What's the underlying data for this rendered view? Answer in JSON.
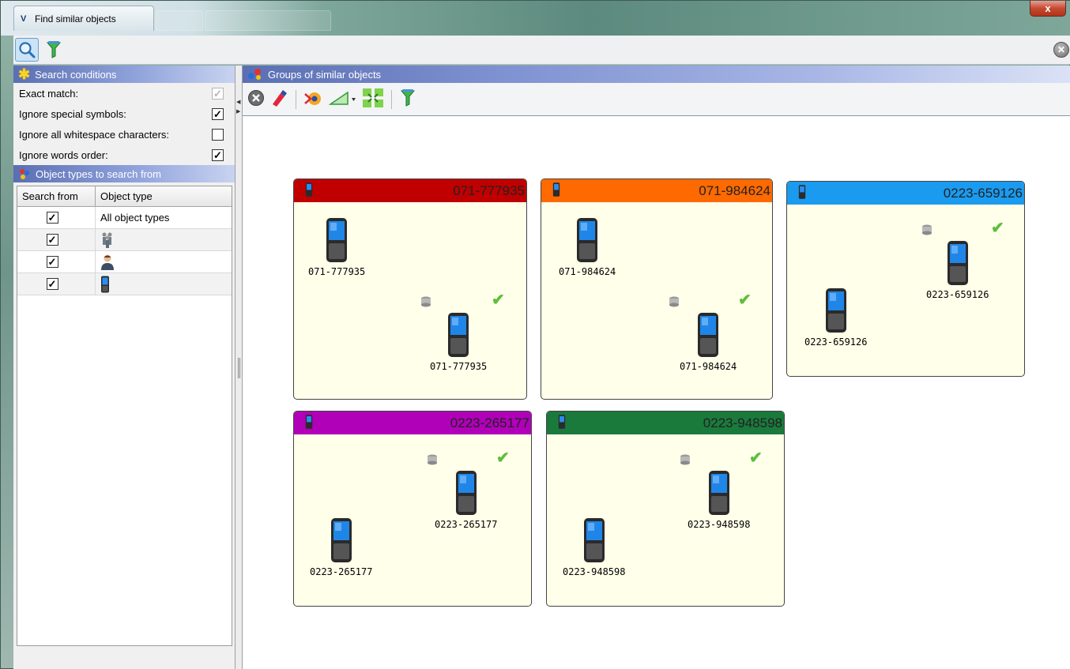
{
  "window": {
    "title": "Find similar objects",
    "close_glyph": "x"
  },
  "toolbar": {
    "search_icon": "search-icon",
    "filter_icon": "funnel-icon",
    "close_glyph": "✕"
  },
  "search_conditions": {
    "header": "Search conditions",
    "rows": [
      {
        "label": "Exact match:",
        "checked": true,
        "enabled": false
      },
      {
        "label": "Ignore special symbols:",
        "checked": true,
        "enabled": true
      },
      {
        "label": "Ignore all whitespace characters:",
        "checked": false,
        "enabled": true
      },
      {
        "label": "Ignore words order:",
        "checked": true,
        "enabled": true
      }
    ]
  },
  "object_types": {
    "header": "Object types to search from",
    "columns": [
      "Search from",
      "Object type"
    ],
    "rows": [
      {
        "checked": true,
        "label": "All object types",
        "icon": ""
      },
      {
        "checked": true,
        "label": "",
        "icon": "group-people-icon"
      },
      {
        "checked": true,
        "label": "",
        "icon": "person-icon"
      },
      {
        "checked": true,
        "label": "",
        "icon": "mobile-phone-icon"
      }
    ]
  },
  "groups_panel": {
    "header": "Groups of similar objects"
  },
  "groups": [
    {
      "title": "071-777935",
      "color": "#c00000",
      "node_a": "071-777935",
      "node_b": "071-777935"
    },
    {
      "title": "071-984624",
      "color": "#ff6a00",
      "node_a": "071-984624",
      "node_b": "071-984624"
    },
    {
      "title": "0223-659126",
      "color": "#1a9bf0",
      "node_a": "0223-659126",
      "node_b": "0223-659126"
    },
    {
      "title": "0223-265177",
      "color": "#b000b8",
      "node_a": "0223-265177",
      "node_b": "0223-265177"
    },
    {
      "title": "0223-948598",
      "color": "#1a7a3c",
      "node_a": "0223-948598",
      "node_b": "0223-948598"
    }
  ],
  "glyphs": {
    "check": "✓",
    "checkmark_ok": "✔"
  }
}
